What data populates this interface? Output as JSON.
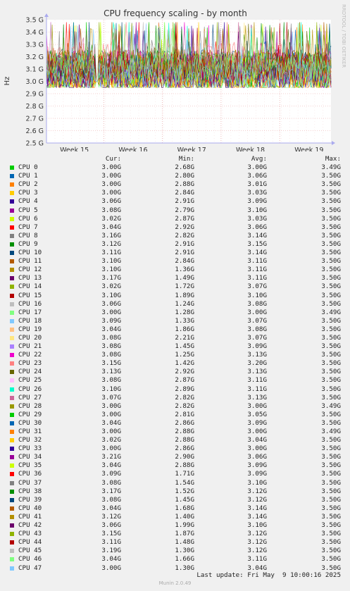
{
  "chart_data": {
    "type": "line",
    "title": "CPU frequency scaling - by month",
    "ylabel": "Hz",
    "side_label": "RRDTOOL / TOBI OETIKER",
    "ylim": [
      2.5,
      3.5
    ],
    "y_ticks": [
      {
        "v": 3.5,
        "label": "3.5 G"
      },
      {
        "v": 3.4,
        "label": "3.4 G"
      },
      {
        "v": 3.3,
        "label": "3.3 G"
      },
      {
        "v": 3.2,
        "label": "3.2 G"
      },
      {
        "v": 3.1,
        "label": "3.1 G"
      },
      {
        "v": 3.0,
        "label": "3.0 G"
      },
      {
        "v": 2.9,
        "label": "2.9 G"
      },
      {
        "v": 2.8,
        "label": "2.8 G"
      },
      {
        "v": 2.7,
        "label": "2.7 G"
      },
      {
        "v": 2.6,
        "label": "2.6 G"
      },
      {
        "v": 2.5,
        "label": "2.5 G"
      }
    ],
    "x_ticks": [
      "Week 15",
      "Week 16",
      "Week 17",
      "Week 18",
      "Week 19"
    ],
    "grid": true,
    "legend_columns": [
      "Cur:",
      "Min:",
      "Avg:",
      "Max:"
    ],
    "series": [
      {
        "name": "CPU 0",
        "color": "#00cc00",
        "cur": "3.00G",
        "min": "2.68G",
        "avg": "3.00G",
        "max": "3.49G"
      },
      {
        "name": "CPU 1",
        "color": "#0066b3",
        "cur": "3.00G",
        "min": "2.80G",
        "avg": "3.06G",
        "max": "3.50G"
      },
      {
        "name": "CPU 2",
        "color": "#ff8000",
        "cur": "3.00G",
        "min": "2.88G",
        "avg": "3.01G",
        "max": "3.50G"
      },
      {
        "name": "CPU 3",
        "color": "#ffcc00",
        "cur": "3.00G",
        "min": "2.84G",
        "avg": "3.03G",
        "max": "3.50G"
      },
      {
        "name": "CPU 4",
        "color": "#330099",
        "cur": "3.06G",
        "min": "2.91G",
        "avg": "3.09G",
        "max": "3.50G"
      },
      {
        "name": "CPU 5",
        "color": "#990099",
        "cur": "3.08G",
        "min": "2.79G",
        "avg": "3.10G",
        "max": "3.50G"
      },
      {
        "name": "CPU 6",
        "color": "#ccff00",
        "cur": "3.02G",
        "min": "2.87G",
        "avg": "3.03G",
        "max": "3.50G"
      },
      {
        "name": "CPU 7",
        "color": "#ff0000",
        "cur": "3.04G",
        "min": "2.92G",
        "avg": "3.06G",
        "max": "3.50G"
      },
      {
        "name": "CPU 8",
        "color": "#808080",
        "cur": "3.16G",
        "min": "2.82G",
        "avg": "3.14G",
        "max": "3.50G"
      },
      {
        "name": "CPU 9",
        "color": "#008f00",
        "cur": "3.12G",
        "min": "2.91G",
        "avg": "3.15G",
        "max": "3.50G"
      },
      {
        "name": "CPU 10",
        "color": "#00487d",
        "cur": "3.11G",
        "min": "2.91G",
        "avg": "3.14G",
        "max": "3.50G"
      },
      {
        "name": "CPU 11",
        "color": "#b35a00",
        "cur": "3.10G",
        "min": "2.84G",
        "avg": "3.11G",
        "max": "3.50G"
      },
      {
        "name": "CPU 12",
        "color": "#b38f00",
        "cur": "3.10G",
        "min": "1.36G",
        "avg": "3.11G",
        "max": "3.50G"
      },
      {
        "name": "CPU 13",
        "color": "#6b006b",
        "cur": "3.17G",
        "min": "1.49G",
        "avg": "3.11G",
        "max": "3.50G"
      },
      {
        "name": "CPU 14",
        "color": "#8fb300",
        "cur": "3.02G",
        "min": "1.72G",
        "avg": "3.07G",
        "max": "3.50G"
      },
      {
        "name": "CPU 15",
        "color": "#b30000",
        "cur": "3.10G",
        "min": "1.89G",
        "avg": "3.10G",
        "max": "3.50G"
      },
      {
        "name": "CPU 16",
        "color": "#bebebe",
        "cur": "3.06G",
        "min": "1.24G",
        "avg": "3.08G",
        "max": "3.50G"
      },
      {
        "name": "CPU 17",
        "color": "#80ff80",
        "cur": "3.00G",
        "min": "1.28G",
        "avg": "3.00G",
        "max": "3.49G"
      },
      {
        "name": "CPU 18",
        "color": "#80c9ff",
        "cur": "3.09G",
        "min": "1.33G",
        "avg": "3.07G",
        "max": "3.50G"
      },
      {
        "name": "CPU 19",
        "color": "#ffc080",
        "cur": "3.04G",
        "min": "1.86G",
        "avg": "3.08G",
        "max": "3.50G"
      },
      {
        "name": "CPU 20",
        "color": "#ffe680",
        "cur": "3.08G",
        "min": "2.21G",
        "avg": "3.07G",
        "max": "3.50G"
      },
      {
        "name": "CPU 21",
        "color": "#aa80ff",
        "cur": "3.08G",
        "min": "1.45G",
        "avg": "3.09G",
        "max": "3.50G"
      },
      {
        "name": "CPU 22",
        "color": "#ee00cc",
        "cur": "3.08G",
        "min": "1.25G",
        "avg": "3.13G",
        "max": "3.50G"
      },
      {
        "name": "CPU 23",
        "color": "#ff8080",
        "cur": "3.15G",
        "min": "1.42G",
        "avg": "3.20G",
        "max": "3.50G"
      },
      {
        "name": "CPU 24",
        "color": "#666600",
        "cur": "3.13G",
        "min": "2.92G",
        "avg": "3.13G",
        "max": "3.50G"
      },
      {
        "name": "CPU 25",
        "color": "#ffbfff",
        "cur": "3.08G",
        "min": "2.87G",
        "avg": "3.11G",
        "max": "3.50G"
      },
      {
        "name": "CPU 26",
        "color": "#00ffcc",
        "cur": "3.10G",
        "min": "2.89G",
        "avg": "3.11G",
        "max": "3.50G"
      },
      {
        "name": "CPU 27",
        "color": "#cc6699",
        "cur": "3.07G",
        "min": "2.82G",
        "avg": "3.13G",
        "max": "3.50G"
      },
      {
        "name": "CPU 28",
        "color": "#999900",
        "cur": "3.00G",
        "min": "2.82G",
        "avg": "3.00G",
        "max": "3.49G"
      },
      {
        "name": "CPU 29",
        "color": "#00cc00",
        "cur": "3.00G",
        "min": "2.81G",
        "avg": "3.05G",
        "max": "3.50G"
      },
      {
        "name": "CPU 30",
        "color": "#0066b3",
        "cur": "3.04G",
        "min": "2.86G",
        "avg": "3.09G",
        "max": "3.50G"
      },
      {
        "name": "CPU 31",
        "color": "#ff8000",
        "cur": "3.00G",
        "min": "2.88G",
        "avg": "3.00G",
        "max": "3.49G"
      },
      {
        "name": "CPU 32",
        "color": "#ffcc00",
        "cur": "3.02G",
        "min": "2.88G",
        "avg": "3.04G",
        "max": "3.50G"
      },
      {
        "name": "CPU 33",
        "color": "#330099",
        "cur": "3.00G",
        "min": "2.86G",
        "avg": "3.00G",
        "max": "3.50G"
      },
      {
        "name": "CPU 34",
        "color": "#990099",
        "cur": "3.21G",
        "min": "2.90G",
        "avg": "3.06G",
        "max": "3.50G"
      },
      {
        "name": "CPU 35",
        "color": "#ccff00",
        "cur": "3.04G",
        "min": "2.88G",
        "avg": "3.09G",
        "max": "3.50G"
      },
      {
        "name": "CPU 36",
        "color": "#ff0000",
        "cur": "3.09G",
        "min": "1.71G",
        "avg": "3.09G",
        "max": "3.50G"
      },
      {
        "name": "CPU 37",
        "color": "#808080",
        "cur": "3.08G",
        "min": "1.54G",
        "avg": "3.10G",
        "max": "3.50G"
      },
      {
        "name": "CPU 38",
        "color": "#008f00",
        "cur": "3.17G",
        "min": "1.52G",
        "avg": "3.12G",
        "max": "3.50G"
      },
      {
        "name": "CPU 39",
        "color": "#00487d",
        "cur": "3.08G",
        "min": "1.45G",
        "avg": "3.12G",
        "max": "3.50G"
      },
      {
        "name": "CPU 40",
        "color": "#b35a00",
        "cur": "3.04G",
        "min": "1.68G",
        "avg": "3.14G",
        "max": "3.50G"
      },
      {
        "name": "CPU 41",
        "color": "#b38f00",
        "cur": "3.12G",
        "min": "1.40G",
        "avg": "3.14G",
        "max": "3.50G"
      },
      {
        "name": "CPU 42",
        "color": "#6b006b",
        "cur": "3.06G",
        "min": "1.99G",
        "avg": "3.10G",
        "max": "3.50G"
      },
      {
        "name": "CPU 43",
        "color": "#8fb300",
        "cur": "3.15G",
        "min": "1.87G",
        "avg": "3.12G",
        "max": "3.50G"
      },
      {
        "name": "CPU 44",
        "color": "#b30000",
        "cur": "3.11G",
        "min": "1.48G",
        "avg": "3.12G",
        "max": "3.50G"
      },
      {
        "name": "CPU 45",
        "color": "#bebebe",
        "cur": "3.19G",
        "min": "1.30G",
        "avg": "3.12G",
        "max": "3.50G"
      },
      {
        "name": "CPU 46",
        "color": "#80ff80",
        "cur": "3.04G",
        "min": "1.66G",
        "avg": "3.11G",
        "max": "3.50G"
      },
      {
        "name": "CPU 47",
        "color": "#80c9ff",
        "cur": "3.00G",
        "min": "1.30G",
        "avg": "3.04G",
        "max": "3.50G"
      }
    ]
  },
  "footer": {
    "last_update": "Last update: Fri May  9 10:00:16 2025",
    "generator": "Munin 2.0.49"
  }
}
